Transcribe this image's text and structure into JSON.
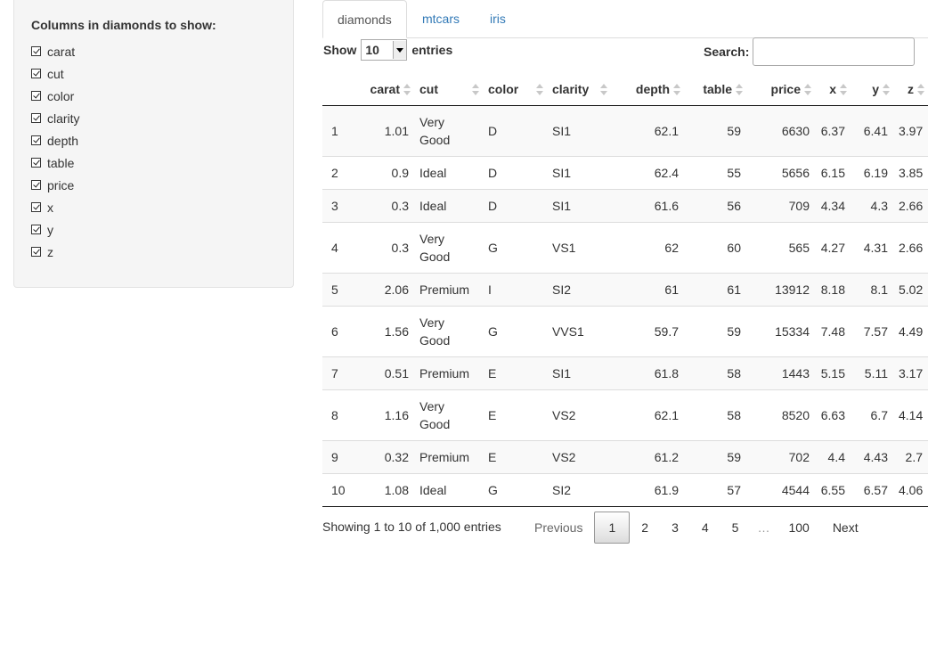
{
  "sidebar": {
    "title": "Columns in diamonds to show:",
    "checkboxes": [
      {
        "label": "carat",
        "checked": true
      },
      {
        "label": "cut",
        "checked": true
      },
      {
        "label": "color",
        "checked": true
      },
      {
        "label": "clarity",
        "checked": true
      },
      {
        "label": "depth",
        "checked": true
      },
      {
        "label": "table",
        "checked": true
      },
      {
        "label": "price",
        "checked": true
      },
      {
        "label": "x",
        "checked": true
      },
      {
        "label": "y",
        "checked": true
      },
      {
        "label": "z",
        "checked": true
      }
    ]
  },
  "tabs": [
    {
      "label": "diamonds",
      "active": true
    },
    {
      "label": "mtcars",
      "active": false
    },
    {
      "label": "iris",
      "active": false
    }
  ],
  "length": {
    "show_label": "Show",
    "selected": "10",
    "entries_label": "entries"
  },
  "search": {
    "label": "Search:",
    "value": ""
  },
  "table": {
    "columns": [
      "",
      "carat",
      "cut",
      "color",
      "clarity",
      "depth",
      "table",
      "price",
      "x",
      "y",
      "z"
    ],
    "rows": [
      [
        "1",
        "1.01",
        "Very Good",
        "D",
        "SI1",
        "62.1",
        "59",
        "6630",
        "6.37",
        "6.41",
        "3.97"
      ],
      [
        "2",
        "0.9",
        "Ideal",
        "D",
        "SI1",
        "62.4",
        "55",
        "5656",
        "6.15",
        "6.19",
        "3.85"
      ],
      [
        "3",
        "0.3",
        "Ideal",
        "D",
        "SI1",
        "61.6",
        "56",
        "709",
        "4.34",
        "4.3",
        "2.66"
      ],
      [
        "4",
        "0.3",
        "Very Good",
        "G",
        "VS1",
        "62",
        "60",
        "565",
        "4.27",
        "4.31",
        "2.66"
      ],
      [
        "5",
        "2.06",
        "Premium",
        "I",
        "SI2",
        "61",
        "61",
        "13912",
        "8.18",
        "8.1",
        "5.02"
      ],
      [
        "6",
        "1.56",
        "Very Good",
        "G",
        "VVS1",
        "59.7",
        "59",
        "15334",
        "7.48",
        "7.57",
        "4.49"
      ],
      [
        "7",
        "0.51",
        "Premium",
        "E",
        "SI1",
        "61.8",
        "58",
        "1443",
        "5.15",
        "5.11",
        "3.17"
      ],
      [
        "8",
        "1.16",
        "Very Good",
        "E",
        "VS2",
        "62.1",
        "58",
        "8520",
        "6.63",
        "6.7",
        "4.14"
      ],
      [
        "9",
        "0.32",
        "Premium",
        "E",
        "VS2",
        "61.2",
        "59",
        "702",
        "4.4",
        "4.43",
        "2.7"
      ],
      [
        "10",
        "1.08",
        "Ideal",
        "G",
        "SI2",
        "61.9",
        "57",
        "4544",
        "6.55",
        "6.57",
        "4.06"
      ]
    ]
  },
  "footer": {
    "info": "Showing 1 to 10 of 1,000 entries",
    "pagination": {
      "previous": "Previous",
      "pages": [
        "1",
        "2",
        "3",
        "4",
        "5"
      ],
      "ellipsis": "…",
      "last_page": "100",
      "next": "Next",
      "current": "1"
    }
  }
}
